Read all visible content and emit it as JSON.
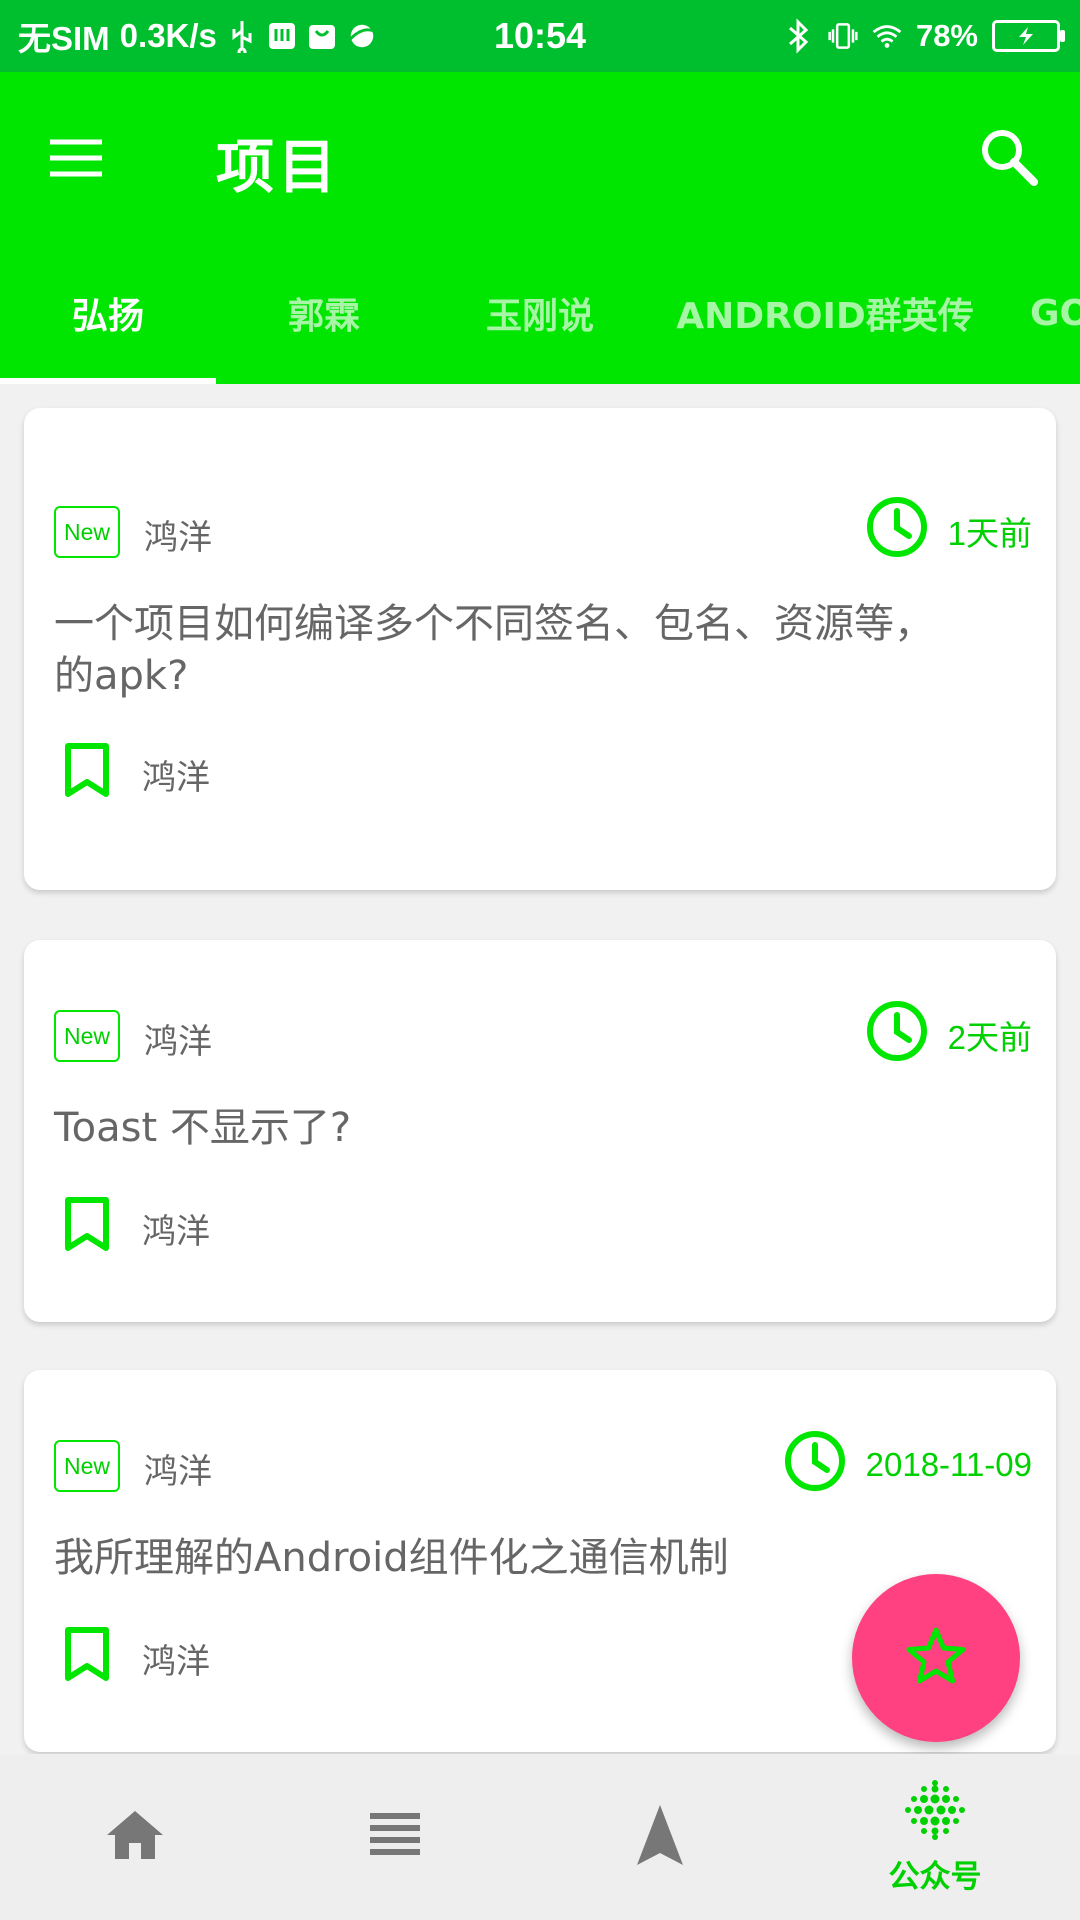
{
  "status_bar": {
    "carrier": "无SIM",
    "speed": "0.3K/s",
    "time": "10:54",
    "battery": "78%"
  },
  "app_bar": {
    "title": "项目",
    "menu_icon": "menu-icon",
    "search_icon": "search-icon"
  },
  "tabs": [
    {
      "label": "弘扬",
      "active": true
    },
    {
      "label": "郭霖",
      "active": false
    },
    {
      "label": "玉刚说",
      "active": false
    },
    {
      "label": "ANDROID群英传",
      "active": false
    },
    {
      "label": "GO",
      "active": false
    }
  ],
  "articles": [
    {
      "badge": "New",
      "author": "鸿洋",
      "time": "1天前",
      "title_lines": [
        "一个项目如何编译多个不同签名、包名、资源等，",
        "的apk?"
      ],
      "chapter": "鸿洋"
    },
    {
      "badge": "New",
      "author": "鸿洋",
      "time": "2天前",
      "title_lines": [
        "Toast 不显示了?"
      ],
      "chapter": "鸿洋"
    },
    {
      "badge": "New",
      "author": "鸿洋",
      "time": "2018-11-09",
      "title_lines": [
        "我所理解的Android组件化之通信机制"
      ],
      "chapter": "鸿洋"
    }
  ],
  "fab_icon": "star-icon",
  "bottom_nav": [
    {
      "icon": "home-icon",
      "label": ""
    },
    {
      "icon": "list-icon",
      "label": ""
    },
    {
      "icon": "navigation-icon",
      "label": ""
    },
    {
      "icon": "wechat-dots-icon",
      "label": "公众号",
      "active": true
    }
  ],
  "colors": {
    "status_bar": "#00bf2f",
    "primary": "#00e600",
    "accent_text": "#00d000",
    "fab": "#ff4081"
  }
}
